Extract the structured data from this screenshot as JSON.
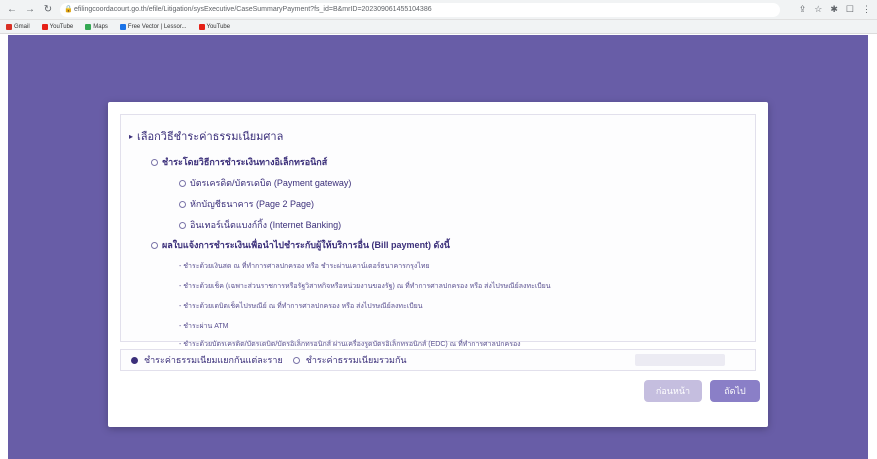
{
  "browser": {
    "url": "efilingcoordacourt.go.th/efile/Litigation/sysExecutive/CaseSummaryPayment?fs_id=B&mrID=202309061455104386",
    "bookmarks": [
      "Gmail",
      "YouTube",
      "Maps",
      "Free Vector | Lessor...",
      "YouTube"
    ]
  },
  "section": {
    "title": "เลือกวิธีชำระค่าธรรมเนียมศาล",
    "electronic": {
      "label": "ชำระโดยวิธีการชำระเงินทางอิเล็กทรอนิกส์",
      "options": [
        "บัตรเครดิต/บัตรเดบิต (Payment gateway)",
        "หักบัญชีธนาคาร (Page 2 Page)",
        "อินเทอร์เน็ตแบงก์กิ้ง (Internet Banking)"
      ]
    },
    "bill": {
      "label": "ผลใบแจ้งการชำระเงินเพื่อนำไปชำระกับผู้ให้บริการอื่น (Bill payment) ดังนี้",
      "items": [
        "- ชำระด้วยเงินสด ณ ที่ทำการศาลปกครอง หรือ ชำระผ่านเคาน์เตอร์ธนาคารกรุงไทย",
        "- ชำระด้วยเช็ค (เฉพาะส่วนราชการหรือรัฐวิสาหกิจหรือหน่วยงานของรัฐ) ณ ที่ทำการศาลปกครอง หรือ ส่งไปรษณีย์ลงทะเบียน",
        "- ชำระด้วยเดบิตเช็คไปรษณีย์ ณ ที่ทำการศาลปกครอง หรือ ส่งไปรษณีย์ลงทะเบียน",
        "- ชำระผ่าน ATM",
        "- ชำระด้วยบัตรเครดิต/บัตรเดบิต/บัตรอิเล็กทรอนิกส์ ผ่านเครื่องรูดบัตรอิเล็กทรอนิกส์ (EDC) ณ ที่ทำการศาลปกครอง"
      ]
    }
  },
  "fee": {
    "opt_separate": "ชำระค่าธรรมเนียมแยกกันแต่ละราย",
    "opt_combined": "ชำระค่าธรรมเนียมรวมกัน"
  },
  "buttons": {
    "prev": "ก่อนหน้า",
    "next": "ถัดไป"
  }
}
